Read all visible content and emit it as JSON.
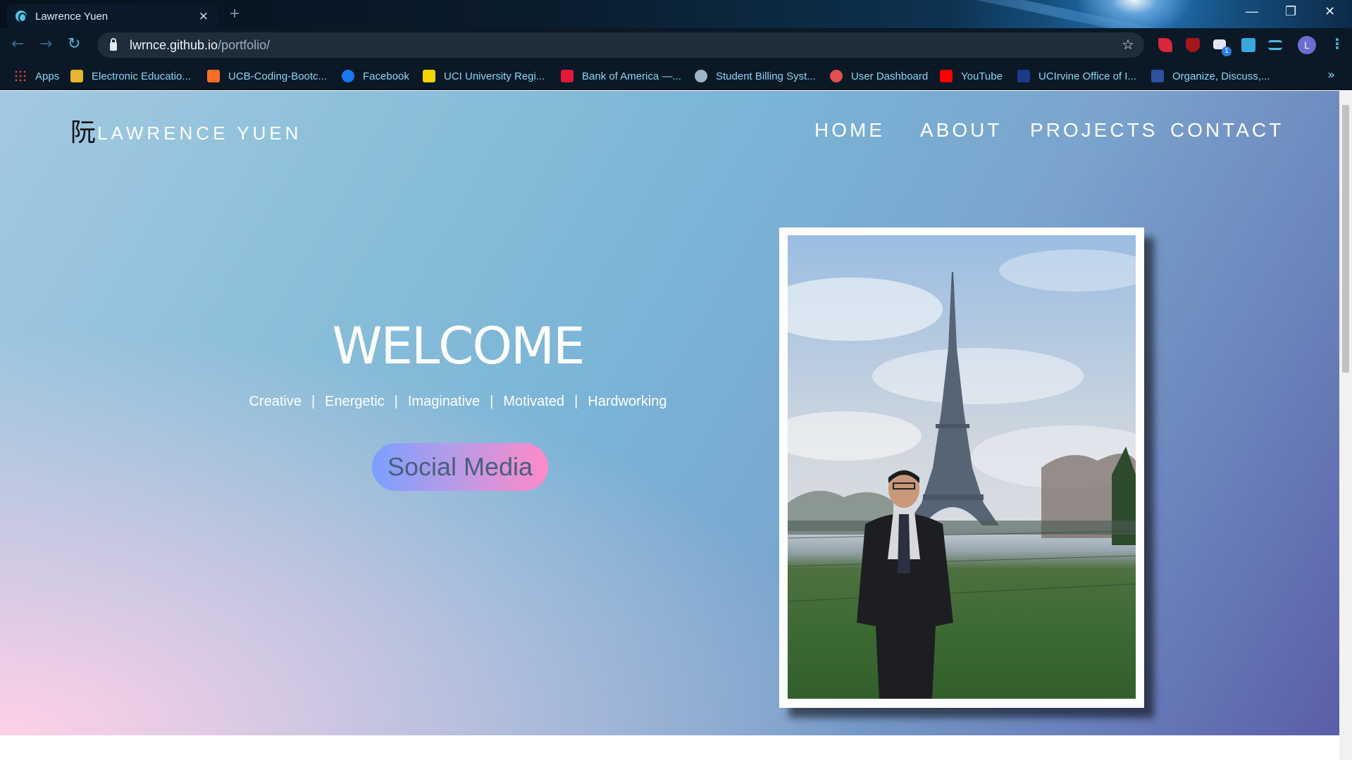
{
  "browser": {
    "tab_title": "Lawrence Yuen",
    "tab_close": "×",
    "new_tab": "+",
    "url_host": "lwrnce.github.io",
    "url_path": "/portfolio/",
    "avatar_letter": "L",
    "extension_badge": "1",
    "window_controls": {
      "minimize": "—",
      "restore": "❐",
      "close": "✕"
    }
  },
  "bookmarks": [
    {
      "label": "Apps",
      "icon": "apps-grid-icon",
      "color": "#e0443e"
    },
    {
      "label": "Electronic Educatio...",
      "icon": "folder-icon",
      "color": "#e8b530"
    },
    {
      "label": "UCB-Coding-Bootc...",
      "icon": "gitlab-icon",
      "color": "#fc6d26"
    },
    {
      "label": "Facebook",
      "icon": "facebook-icon",
      "color": "#1877f2"
    },
    {
      "label": "UCI University Regi...",
      "icon": "reg-icon",
      "color": "#f5d300"
    },
    {
      "label": "Bank of America —...",
      "icon": "bofa-icon",
      "color": "#e31837"
    },
    {
      "label": "Student Billing Syst...",
      "icon": "globe-icon",
      "color": "#9fb4c4"
    },
    {
      "label": "User Dashboard",
      "icon": "dashboard-icon",
      "color": "#e05050"
    },
    {
      "label": "YouTube",
      "icon": "youtube-icon",
      "color": "#ff0000"
    },
    {
      "label": "UCIrvine Office of I...",
      "icon": "uci-icon",
      "color": "#1b3a8a"
    },
    {
      "label": "Organize, Discuss,...",
      "icon": "mal-icon",
      "color": "#2e51a2"
    }
  ],
  "site": {
    "brand_hanzi": "阮",
    "brand_name": "LAWRENCE YUEN",
    "nav": [
      "HOME",
      "ABOUT",
      "PROJECTS",
      "CONTACT"
    ],
    "welcome": "WELCOME",
    "traits": [
      "Creative",
      "Energetic",
      "Imaginative",
      "Motivated",
      "Hardworking"
    ],
    "trait_separator": "|",
    "social_button": "Social Media"
  },
  "colors": {
    "hero_start": "#a2c9e1",
    "hero_end": "#5a5ea8",
    "hero_pink": "#ffd0e8",
    "button_left": "#7c9fff",
    "button_right": "#ff8ac8"
  }
}
